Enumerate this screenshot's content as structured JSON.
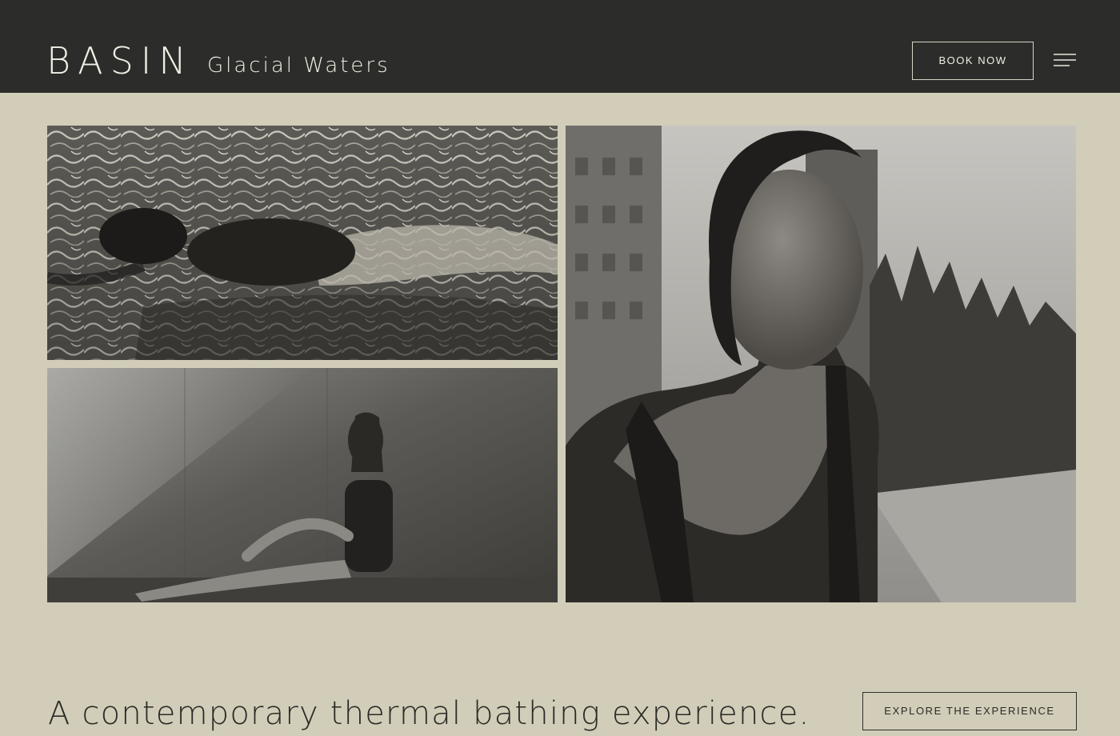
{
  "header": {
    "logo": "BASIN",
    "tagline": "Glacial Waters",
    "book_label": "BOOK NOW",
    "menu_icon": "hamburger-menu-icon"
  },
  "gallery": {
    "images": [
      {
        "name": "photo-swimmer-underwater",
        "depicts": "woman swimming under rippling water"
      },
      {
        "name": "photo-woman-sitting-by-wall",
        "depicts": "woman sitting against a wall in soft light"
      },
      {
        "name": "photo-woman-portrait-outdoors",
        "depicts": "portrait of a woman outdoors with buildings and trees"
      }
    ]
  },
  "intro": {
    "headline": "A contemporary thermal bathing experience.",
    "explore_label": "EXPLORE THE EXPERIENCE"
  },
  "colors": {
    "header_bg": "#2c2d2a",
    "page_bg": "#d1cdb8",
    "text_dark": "#2b2b27",
    "text_light": "#f1efe6"
  }
}
